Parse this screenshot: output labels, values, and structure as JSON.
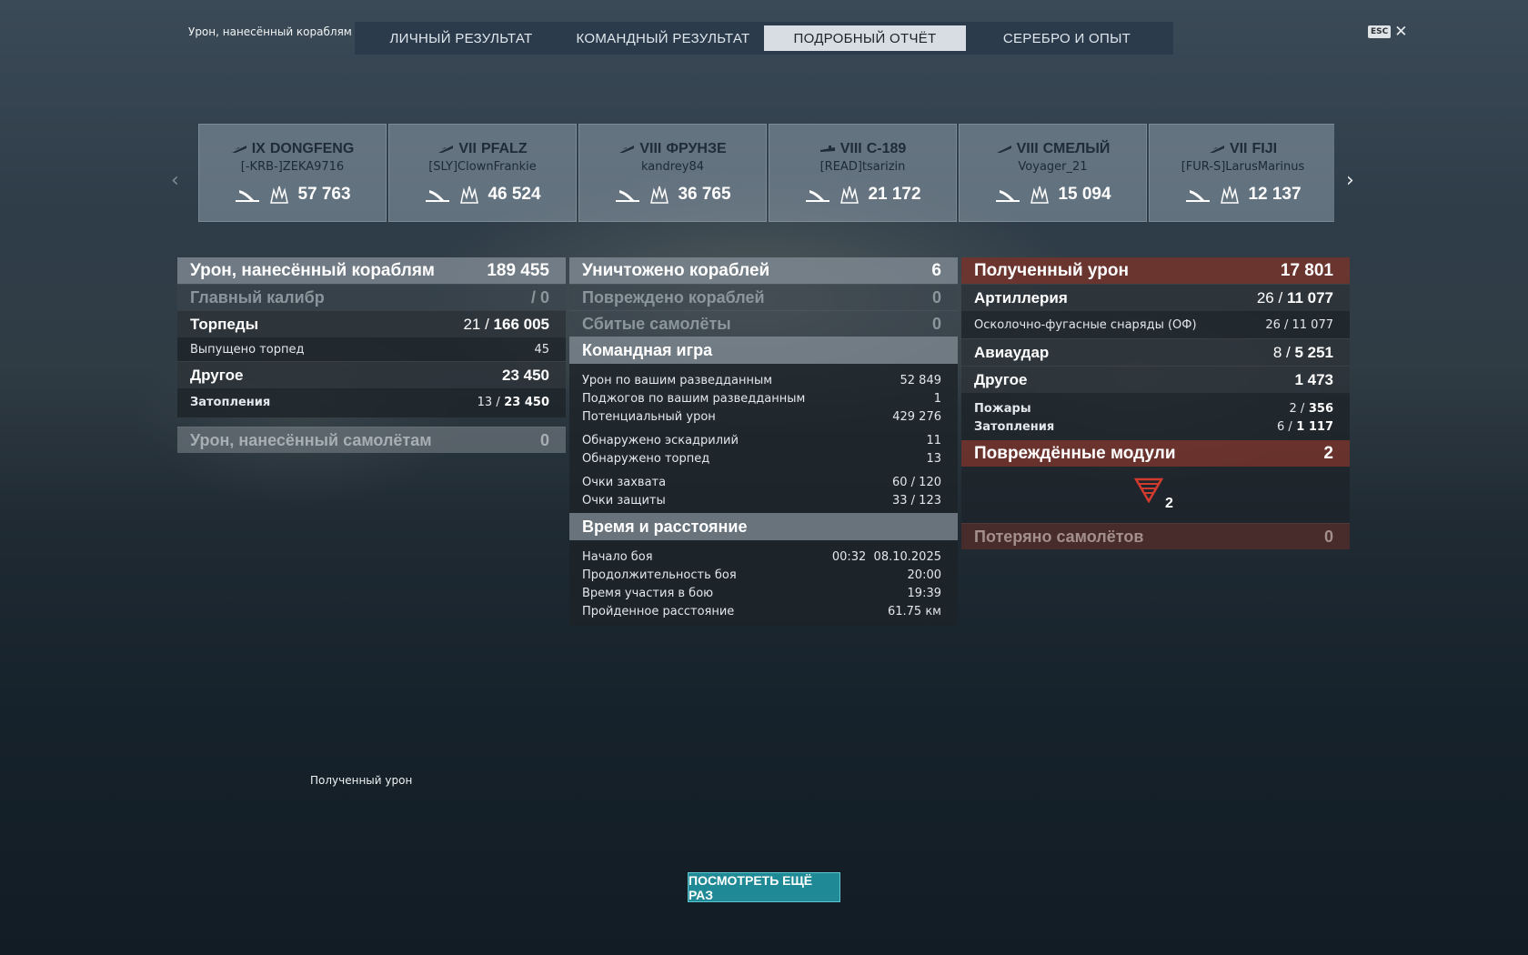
{
  "header": {
    "top_label": "Урон, нанесённый кораблям",
    "tabs": [
      "ЛИЧНЫЙ РЕЗУЛЬТАТ",
      "КОМАНДНЫЙ РЕЗУЛЬТАТ",
      "ПОДРОБНЫЙ ОТЧЁТ",
      "СЕРЕБРО И ОПЫТ"
    ],
    "active_tab": "ПОДРОБНЫЙ ОТЧЁТ",
    "esc_label": "ESC",
    "close_glyph": "✕"
  },
  "ships": [
    {
      "tier": "IX",
      "name": "DONGFENG",
      "player": "[-KRB-]ZEKA9716",
      "damage": "57 763",
      "class_icon": "destroyer-icon"
    },
    {
      "tier": "VII",
      "name": "PFALZ",
      "player": "[SLY]ClownFrankie",
      "damage": "46 524",
      "class_icon": "destroyer-icon"
    },
    {
      "tier": "VIII",
      "name": "ФРУНЗЕ",
      "player": "kandrey84",
      "damage": "36 765",
      "class_icon": "destroyer-icon"
    },
    {
      "tier": "VIII",
      "name": "С-189",
      "player": "[READ]tsarizin",
      "damage": "21 172",
      "class_icon": "submarine-icon"
    },
    {
      "tier": "VIII",
      "name": "СМЕЛЫЙ",
      "player": "Voyager_21",
      "damage": "15 094",
      "class_icon": "destroyer-icon"
    },
    {
      "tier": "VII",
      "name": "FIJI",
      "player": "[FUR-S]LarusMarinus",
      "damage": "12 137",
      "class_icon": "cruiser-icon"
    }
  ],
  "left": {
    "main": {
      "label": "Урон, нанесённый кораблям",
      "value": "189 455"
    },
    "main_caliber": {
      "label": "Главный калибр",
      "value": "/ 0"
    },
    "torpedoes": {
      "label": "Торпеды",
      "count": "21 /",
      "value": "166 005"
    },
    "torpedoes_fired": {
      "label": "Выпущено торпед",
      "value": "45"
    },
    "other": {
      "label": "Другое",
      "value": "23 450"
    },
    "flooding": {
      "label": "Затопления",
      "count": "13 /",
      "value": "23 450"
    },
    "planes_damage": {
      "label": "Урон, нанесённый самолётам",
      "value": "0"
    }
  },
  "middle": {
    "destroyed": {
      "label": "Уничтожено кораблей",
      "value": "6"
    },
    "damaged": {
      "label": "Повреждено кораблей",
      "value": "0"
    },
    "planes_shot": {
      "label": "Сбитые самолёты",
      "value": "0"
    },
    "team_title": "Командная игра",
    "team_rows": [
      {
        "label": "Урон по вашим разведданным",
        "value": "52 849"
      },
      {
        "label": "Поджогов по вашим разведданным",
        "value": "1"
      },
      {
        "label": "Потенциальный урон",
        "value": "429 276"
      },
      {
        "label": "Обнаружено эскадрилий",
        "value": "11"
      },
      {
        "label": "Обнаружено торпед",
        "value": "13"
      },
      {
        "label": "Очки захвата",
        "value": "60 / 120"
      },
      {
        "label": "Очки защиты",
        "value": "33 / 123"
      }
    ],
    "time_title": "Время и расстояние",
    "time_rows": [
      {
        "label": "Начало боя",
        "value": "00:32  08.10.2025"
      },
      {
        "label": "Продолжительность боя",
        "value": "20:00"
      },
      {
        "label": "Время участия в бою",
        "value": "19:39"
      },
      {
        "label": "Пройденное расстояние",
        "value": "61.75 км"
      }
    ]
  },
  "right": {
    "received": {
      "label": "Полученный урон",
      "value": "17 801"
    },
    "artillery": {
      "label": "Артиллерия",
      "count": "26 /",
      "value": "11 077"
    },
    "he_shells": {
      "label": "Осколочно-фугасные снаряды (ОФ)",
      "value": "26 / 11 077"
    },
    "airstrike": {
      "label": "Авиаудар",
      "count": "8 /",
      "value": "5 251"
    },
    "other": {
      "label": "Другое",
      "value": "1 473"
    },
    "fires": {
      "label": "Пожары",
      "count": "2 /",
      "value": "356"
    },
    "flooding": {
      "label": "Затопления",
      "count": "6 /",
      "value": "1 117"
    },
    "modules": {
      "label": "Повреждённые модули",
      "value": "2",
      "icon_count": "2",
      "icon": "damaged-module-icon",
      "icon_color": "#d23a2e"
    },
    "planes_lost": {
      "label": "Потеряно самолётов",
      "value": "0"
    }
  },
  "footer": {
    "bottom_label": "Полученный урон",
    "replay_button": "ПОСМОТРЕТЬ ЕЩЁ РАЗ"
  },
  "colors": {
    "active_tab_bg": "#d7dde2",
    "replay_button": "#1f8a96",
    "received_header": "#783228"
  }
}
